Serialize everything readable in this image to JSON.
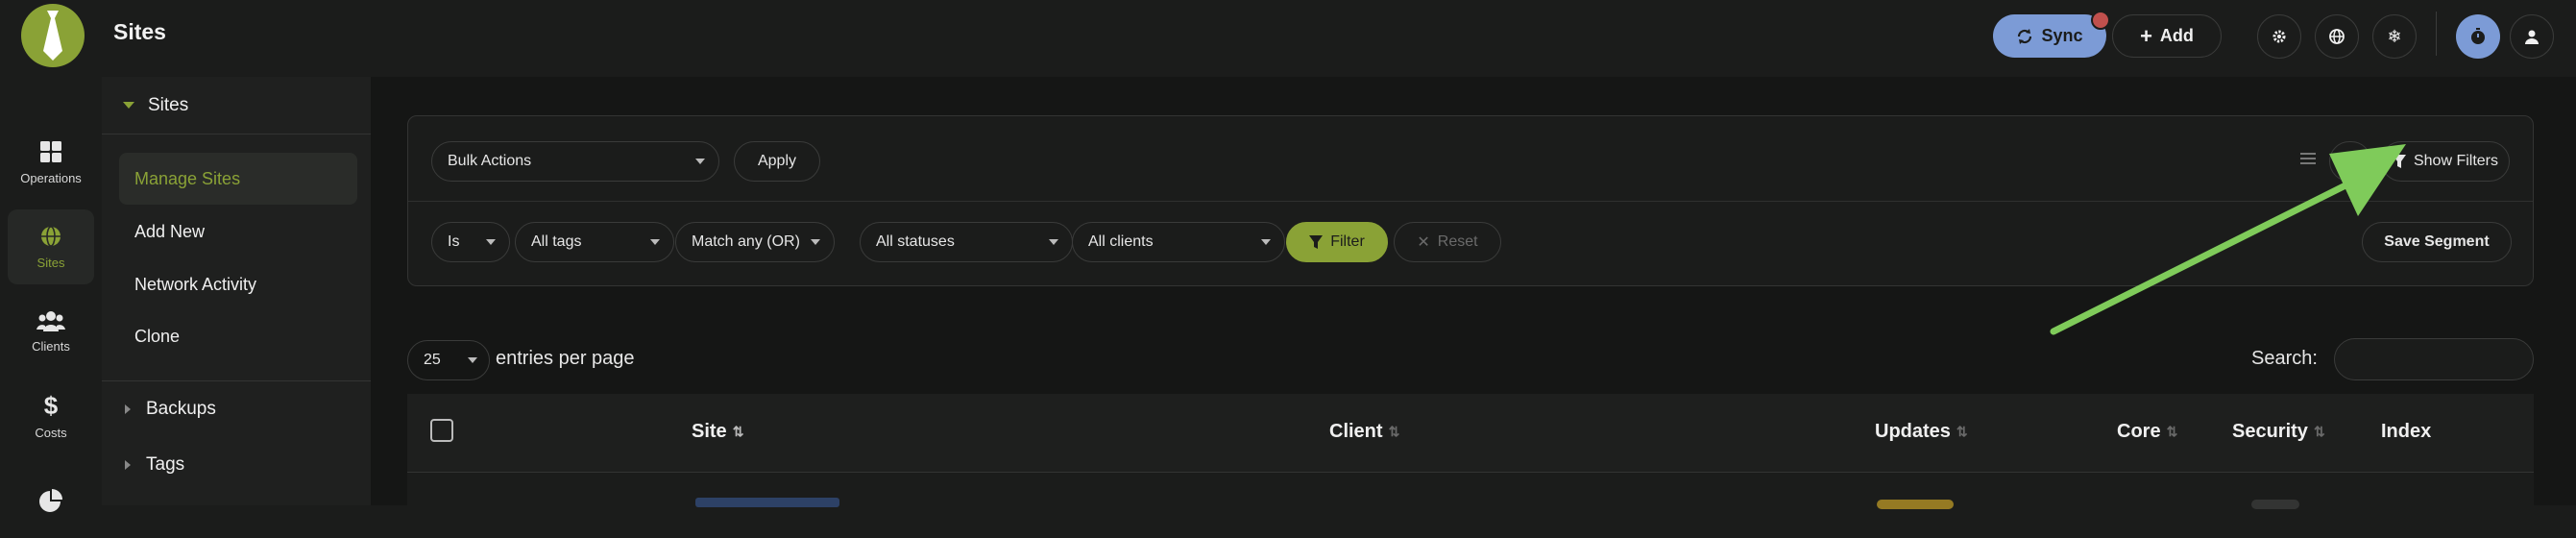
{
  "header": {
    "title": "Sites",
    "sync_label": "Sync",
    "add_label": "Add"
  },
  "leftnav": {
    "items": [
      {
        "label": "Operations",
        "icon": "grid-icon"
      },
      {
        "label": "Sites",
        "icon": "globe-icon"
      },
      {
        "label": "Clients",
        "icon": "users-icon"
      },
      {
        "label": "Costs",
        "icon": "dollar-icon"
      },
      {
        "label": "",
        "icon": "pie-chart-icon"
      }
    ]
  },
  "subnav": {
    "header": "Sites",
    "links": [
      "Manage Sites",
      "Add New",
      "Network Activity",
      "Clone"
    ],
    "sections": [
      "Backups",
      "Tags"
    ]
  },
  "toolbar": {
    "bulk_actions": "Bulk Actions",
    "apply": "Apply",
    "show_filters": "Show Filters"
  },
  "filters": {
    "is": "Is",
    "tags": "All tags",
    "match": "Match any (OR)",
    "statuses": "All statuses",
    "clients": "All clients",
    "filter_label": "Filter",
    "reset_label": "Reset",
    "save_segment": "Save Segment"
  },
  "listing": {
    "per_page_value": "25",
    "per_page_label": "entries per page",
    "search_label": "Search:"
  },
  "table": {
    "columns": [
      "Site",
      "Client",
      "Updates",
      "Core",
      "Security",
      "Index"
    ]
  },
  "colors": {
    "accent": "#8aa236",
    "sync": "#7c9bd6",
    "arrow": "#7fcb5a"
  }
}
